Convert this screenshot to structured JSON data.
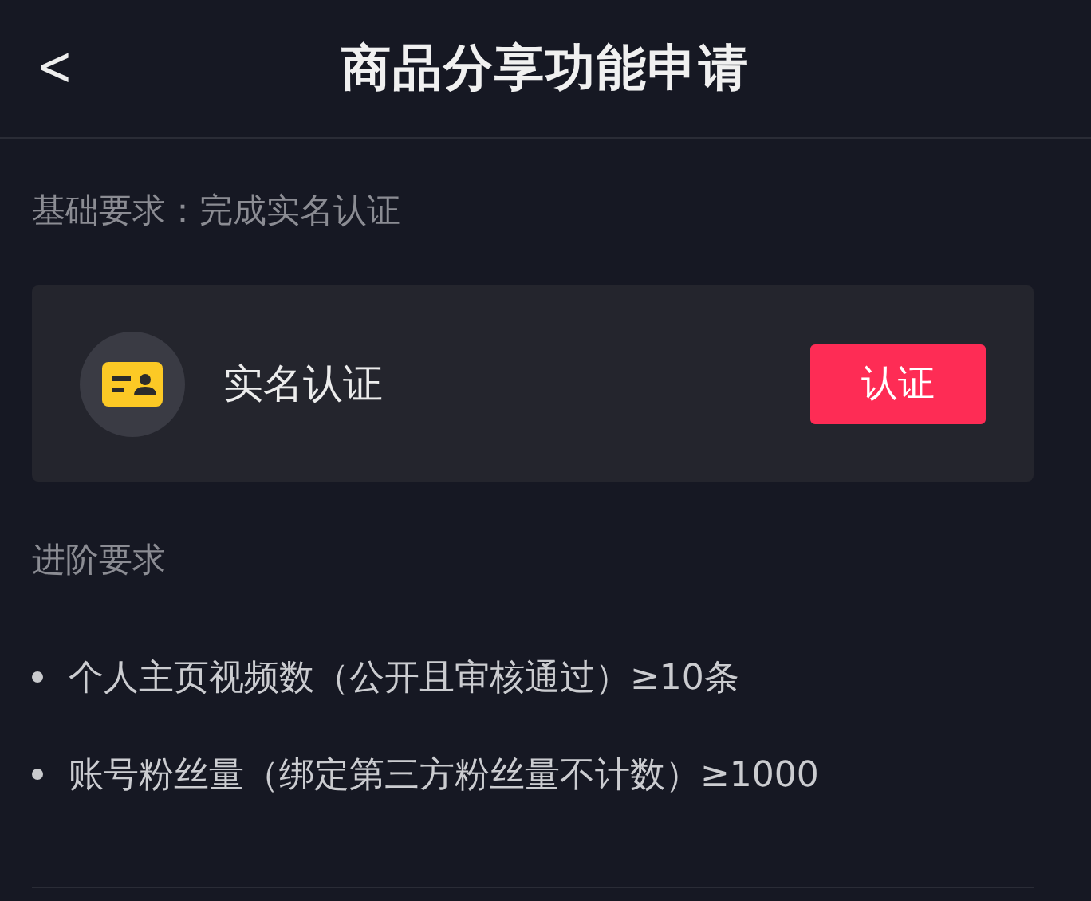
{
  "header": {
    "back": "<",
    "title": "商品分享功能申请"
  },
  "basic": {
    "label": "基础要求：完成实名认证",
    "card": {
      "title": "实名认证",
      "button": "认证"
    }
  },
  "advanced": {
    "label": "进阶要求",
    "items": [
      {
        "text": "个人主页视频数（公开且审核通过）≥10条"
      },
      {
        "text": "账号粉丝量（绑定第三方粉丝量不计数）≥1000"
      }
    ]
  }
}
